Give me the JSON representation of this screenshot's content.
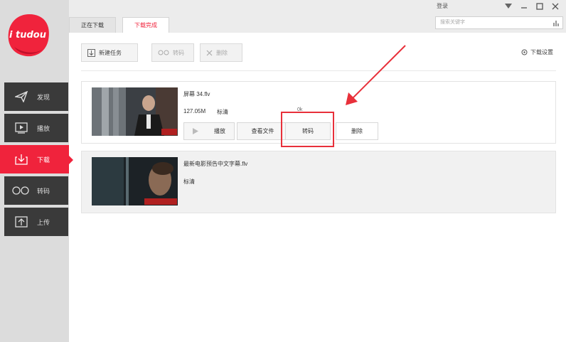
{
  "app": {
    "logo_text": "i tudou",
    "brand_color": "#f0233c"
  },
  "window": {
    "user": "登录",
    "search_placeholder": "搜索关键字"
  },
  "tabs": [
    {
      "label": "正在下载",
      "active": false
    },
    {
      "label": "下载完成",
      "active": true
    }
  ],
  "sidebar": {
    "items": [
      {
        "label": "发现",
        "icon": "paper-plane-icon",
        "active": false
      },
      {
        "label": "播放",
        "icon": "play-screen-icon",
        "active": false
      },
      {
        "label": "下载",
        "icon": "download-icon",
        "active": true
      },
      {
        "label": "转码",
        "icon": "infinity-icon",
        "active": false
      },
      {
        "label": "上传",
        "icon": "upload-icon",
        "active": false
      }
    ]
  },
  "toolbar": {
    "new_task": "新建任务",
    "transcode": "转码",
    "delete": "删除",
    "download_settings": "下载设置"
  },
  "downloads": [
    {
      "filename": "屏幕 34.flv",
      "size": "127.05M",
      "quality": "标清",
      "status": "0k",
      "actions": {
        "play": "播放",
        "open_folder": "查看文件",
        "transcode": "转码",
        "delete": "删除"
      }
    },
    {
      "filename": "最新电影预告中文字幕.flv",
      "quality": "标清"
    }
  ]
}
